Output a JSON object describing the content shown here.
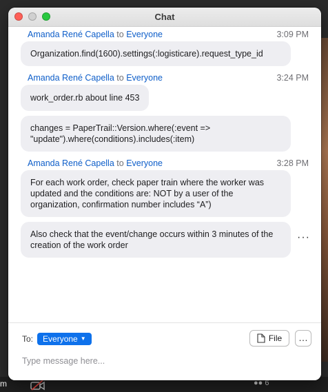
{
  "window": {
    "title": "Chat"
  },
  "background": {
    "left_label": "m",
    "participants_count": "6"
  },
  "messages": [
    {
      "sender": "Amanda René Capella",
      "to_word": "to",
      "recipient": "Everyone",
      "time": "3:09 PM",
      "bubbles": [
        "Organization.find(1600).settings(:logisticare).request_type_id"
      ]
    },
    {
      "sender": "Amanda René Capella",
      "to_word": "to",
      "recipient": "Everyone",
      "time": "3:24 PM",
      "bubbles": [
        "work_order.rb about line 453",
        "changes = PaperTrail::Version.where(:event => \"update\").where(conditions).includes(:item)"
      ]
    },
    {
      "sender": "Amanda René Capella",
      "to_word": "to",
      "recipient": "Everyone",
      "time": "3:28 PM",
      "bubbles": [
        "For each work order, check paper train where the worker was updated and the conditions are: NOT by a user of the organization, confirmation number includes “A”)",
        "Also check that the event/change occurs within 3 minutes of the creation of the work order"
      ]
    }
  ],
  "composer": {
    "to_label": "To:",
    "recipient": "Everyone",
    "file_label": "File",
    "more_label": "…",
    "placeholder": "Type message here..."
  },
  "icons": {
    "message_more": "more-horizontal-icon",
    "file": "file-icon",
    "caret": "chevron-down-icon"
  }
}
